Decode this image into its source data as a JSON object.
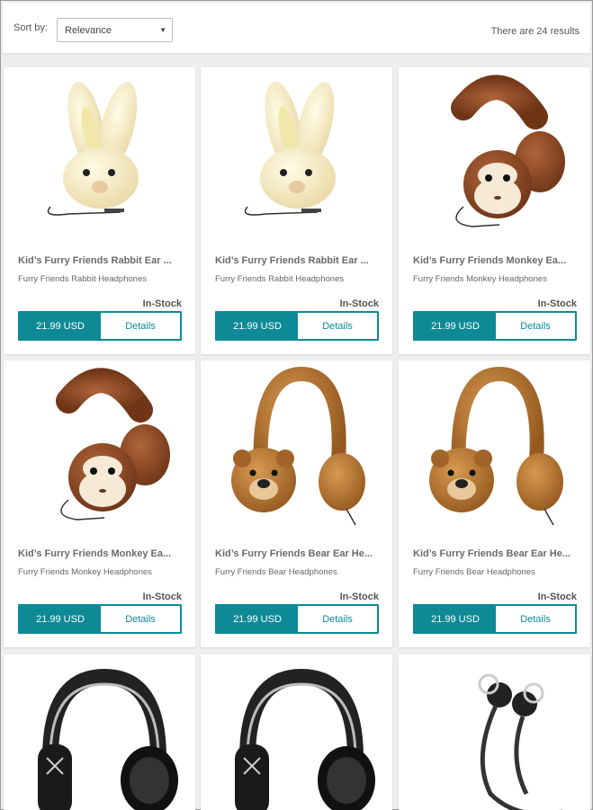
{
  "toolbar": {
    "sort_label": "Sort by:",
    "sort_value": "Relevance",
    "results_text": "There are 24 results"
  },
  "products": [
    {
      "title": "Kid’s Furry Friends Rabbit Ear ...",
      "subtitle": "Furry Friends Rabbit Headphones",
      "stock": "In-Stock",
      "price": "21.99 USD",
      "details": "Details",
      "image": "rabbit-headphones"
    },
    {
      "title": "Kid’s Furry Friends Rabbit Ear ...",
      "subtitle": "Furry Friends Rabbit Headphones",
      "stock": "In-Stock",
      "price": "21.99 USD",
      "details": "Details",
      "image": "rabbit-headphones"
    },
    {
      "title": "Kid’s Furry Friends Monkey Ea...",
      "subtitle": "Furry Friends Monkey Headphones",
      "stock": "In-Stock",
      "price": "21.99 USD",
      "details": "Details",
      "image": "monkey-headphones"
    },
    {
      "title": "Kid’s Furry Friends Monkey Ea...",
      "subtitle": "Furry Friends Monkey Headphones",
      "stock": "In-Stock",
      "price": "21.99 USD",
      "details": "Details",
      "image": "monkey-headphones"
    },
    {
      "title": "Kid’s Furry Friends Bear Ear He...",
      "subtitle": "Furry Friends Bear Headphones",
      "stock": "In-Stock",
      "price": "21.99 USD",
      "details": "Details",
      "image": "bear-headphones"
    },
    {
      "title": "Kid’s Furry Friends Bear Ear He...",
      "subtitle": "Furry Friends Bear Headphones",
      "stock": "In-Stock",
      "price": "21.99 USD",
      "details": "Details",
      "image": "bear-headphones"
    },
    {
      "image": "black-over-ear-headphones"
    },
    {
      "image": "black-over-ear-headphones"
    },
    {
      "image": "wireless-sport-earbuds"
    }
  ],
  "colors": {
    "accent": "#0e8a96"
  }
}
